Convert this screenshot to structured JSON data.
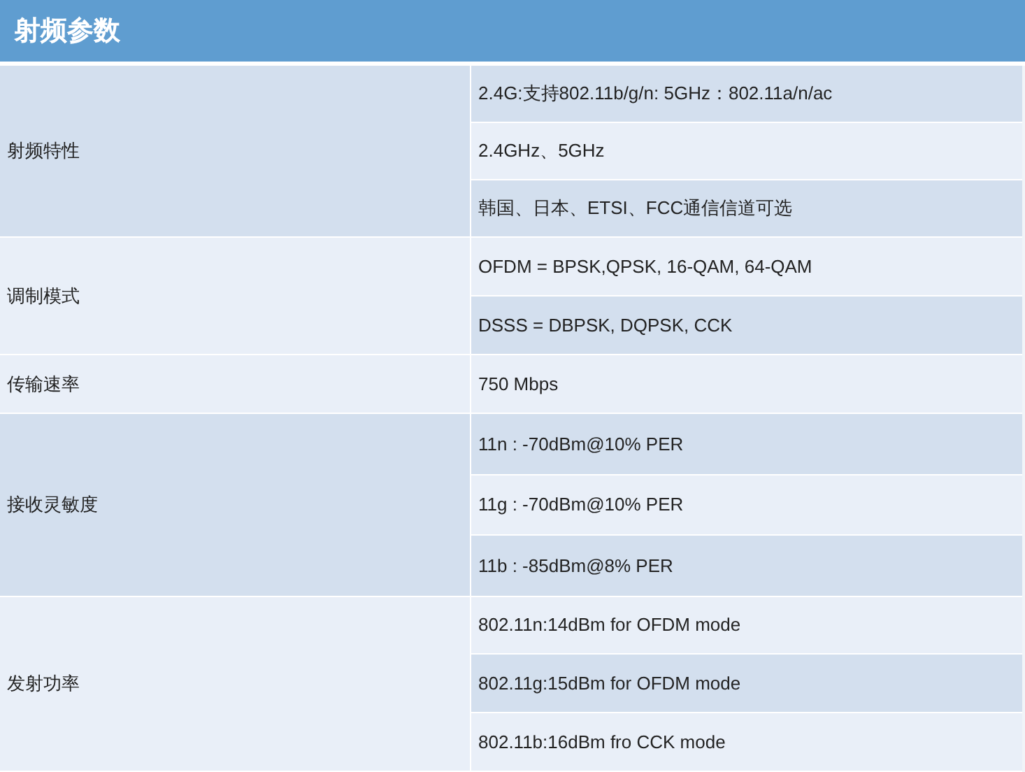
{
  "title": "射频参数",
  "groups": [
    {
      "label": "射频特性",
      "shaded": true,
      "values": [
        {
          "text": "2.4G:支持802.11b/g/n: 5GHz：802.11a/n/ac",
          "shaded": true
        },
        {
          "text": "2.4GHz、5GHz",
          "shaded": false
        },
        {
          "text": "韩国、日本、ETSI、FCC通信信道可选",
          "shaded": true
        }
      ]
    },
    {
      "label": "调制模式",
      "shaded": false,
      "values": [
        {
          "text": "OFDM = BPSK,QPSK, 16-QAM, 64-QAM",
          "shaded": false
        },
        {
          "text": "DSSS = DBPSK, DQPSK, CCK",
          "shaded": true
        }
      ]
    },
    {
      "label": "传输速率",
      "shaded": false,
      "values": [
        {
          "text": "750 Mbps",
          "shaded": false
        }
      ]
    },
    {
      "label": "接收灵敏度",
      "shaded": true,
      "values": [
        {
          "text": "11n : -70dBm@10% PER",
          "shaded": true
        },
        {
          "text": "11g : -70dBm@10% PER",
          "shaded": false
        },
        {
          "text": "11b : -85dBm@8% PER",
          "shaded": true
        }
      ]
    },
    {
      "label": "发射功率",
      "shaded": false,
      "values": [
        {
          "text": "802.11n:14dBm for OFDM mode",
          "shaded": false
        },
        {
          "text": "802.11g:15dBm for OFDM mode",
          "shaded": true
        },
        {
          "text": "802.11b:16dBm fro CCK mode",
          "shaded": false
        }
      ]
    }
  ]
}
